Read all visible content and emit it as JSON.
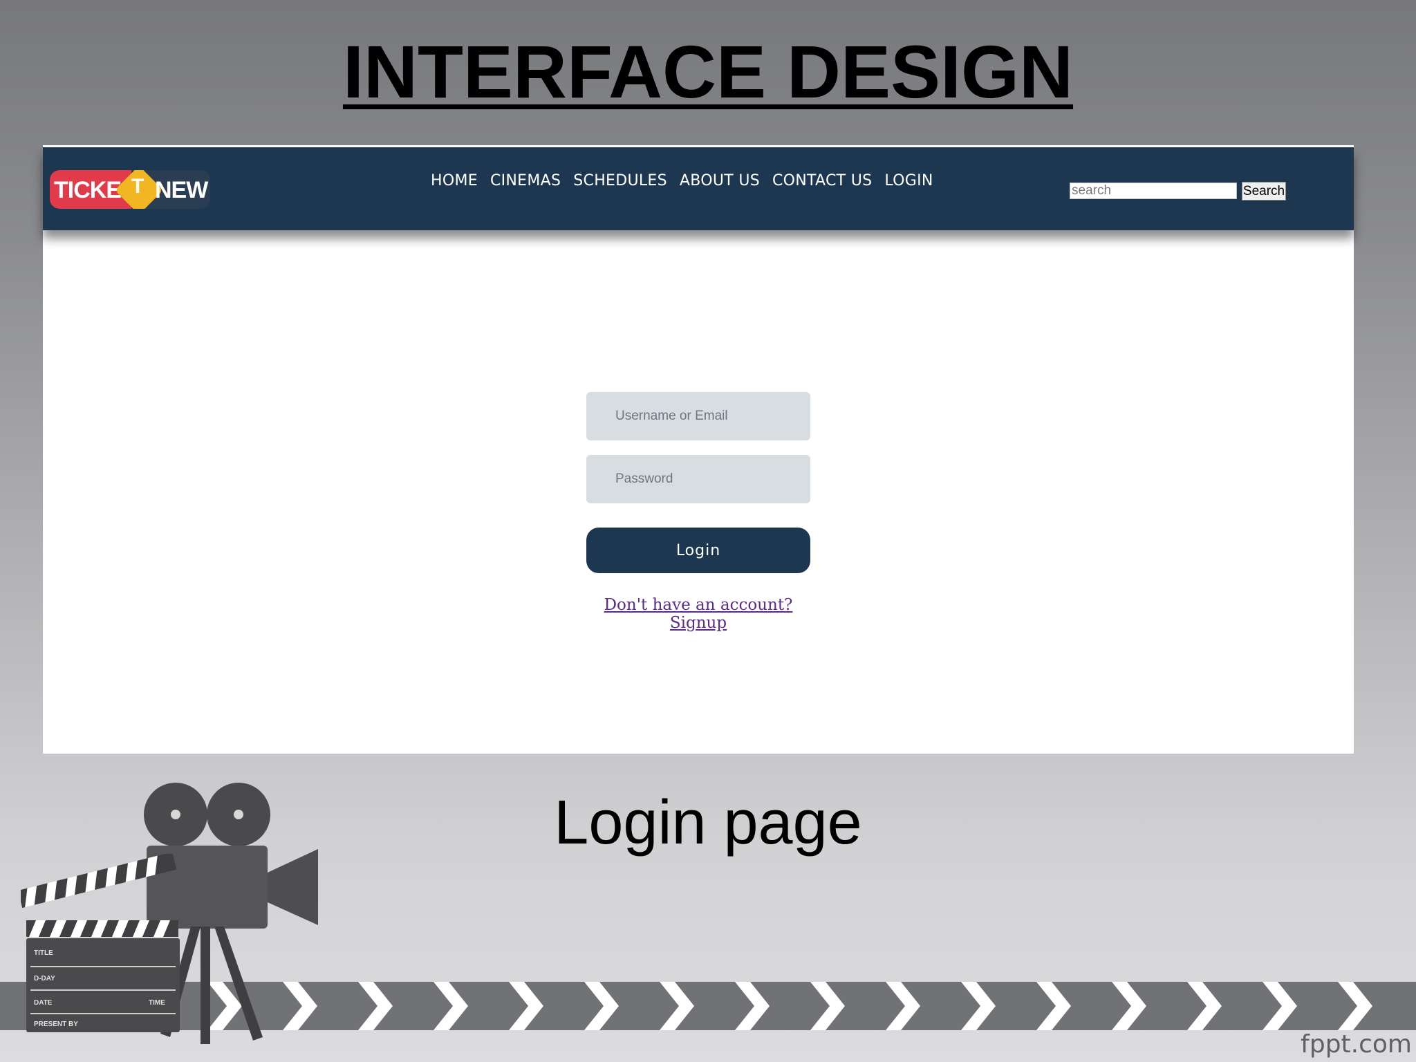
{
  "slide": {
    "title": "INTERFACE DESIGN",
    "caption": "Login page",
    "watermark": "fppt.com"
  },
  "app": {
    "logo": {
      "text_left": "TICKE",
      "text_mark": "T",
      "text_right": "NEW"
    },
    "nav": {
      "items": [
        {
          "label": "HOME"
        },
        {
          "label": "CINEMAS"
        },
        {
          "label": "SCHEDULES"
        },
        {
          "label": "ABOUT US"
        },
        {
          "label": "CONTACT US"
        },
        {
          "label": "LOGIN"
        }
      ]
    },
    "search": {
      "placeholder": "search",
      "button_label": "Search"
    },
    "login_form": {
      "username_placeholder": "Username or Email",
      "password_placeholder": "Password",
      "login_label": "Login",
      "signup_link": "Don't have an account? Signup"
    }
  },
  "clapperboard": {
    "row1": "TITLE",
    "row2": "D-DAY",
    "row3_left": "DATE",
    "row3_right": "TIME",
    "row4": "PRESENT BY"
  },
  "colors": {
    "navbar": "#1e3750",
    "logo_red": "#e03a4b",
    "logo_yellow": "#f3b623",
    "link_purple": "#5b2a8c",
    "field_bg": "#d8dde2"
  },
  "icons": [
    "film-camera-icon",
    "clapperboard-icon",
    "chevron-arrow-icon"
  ]
}
